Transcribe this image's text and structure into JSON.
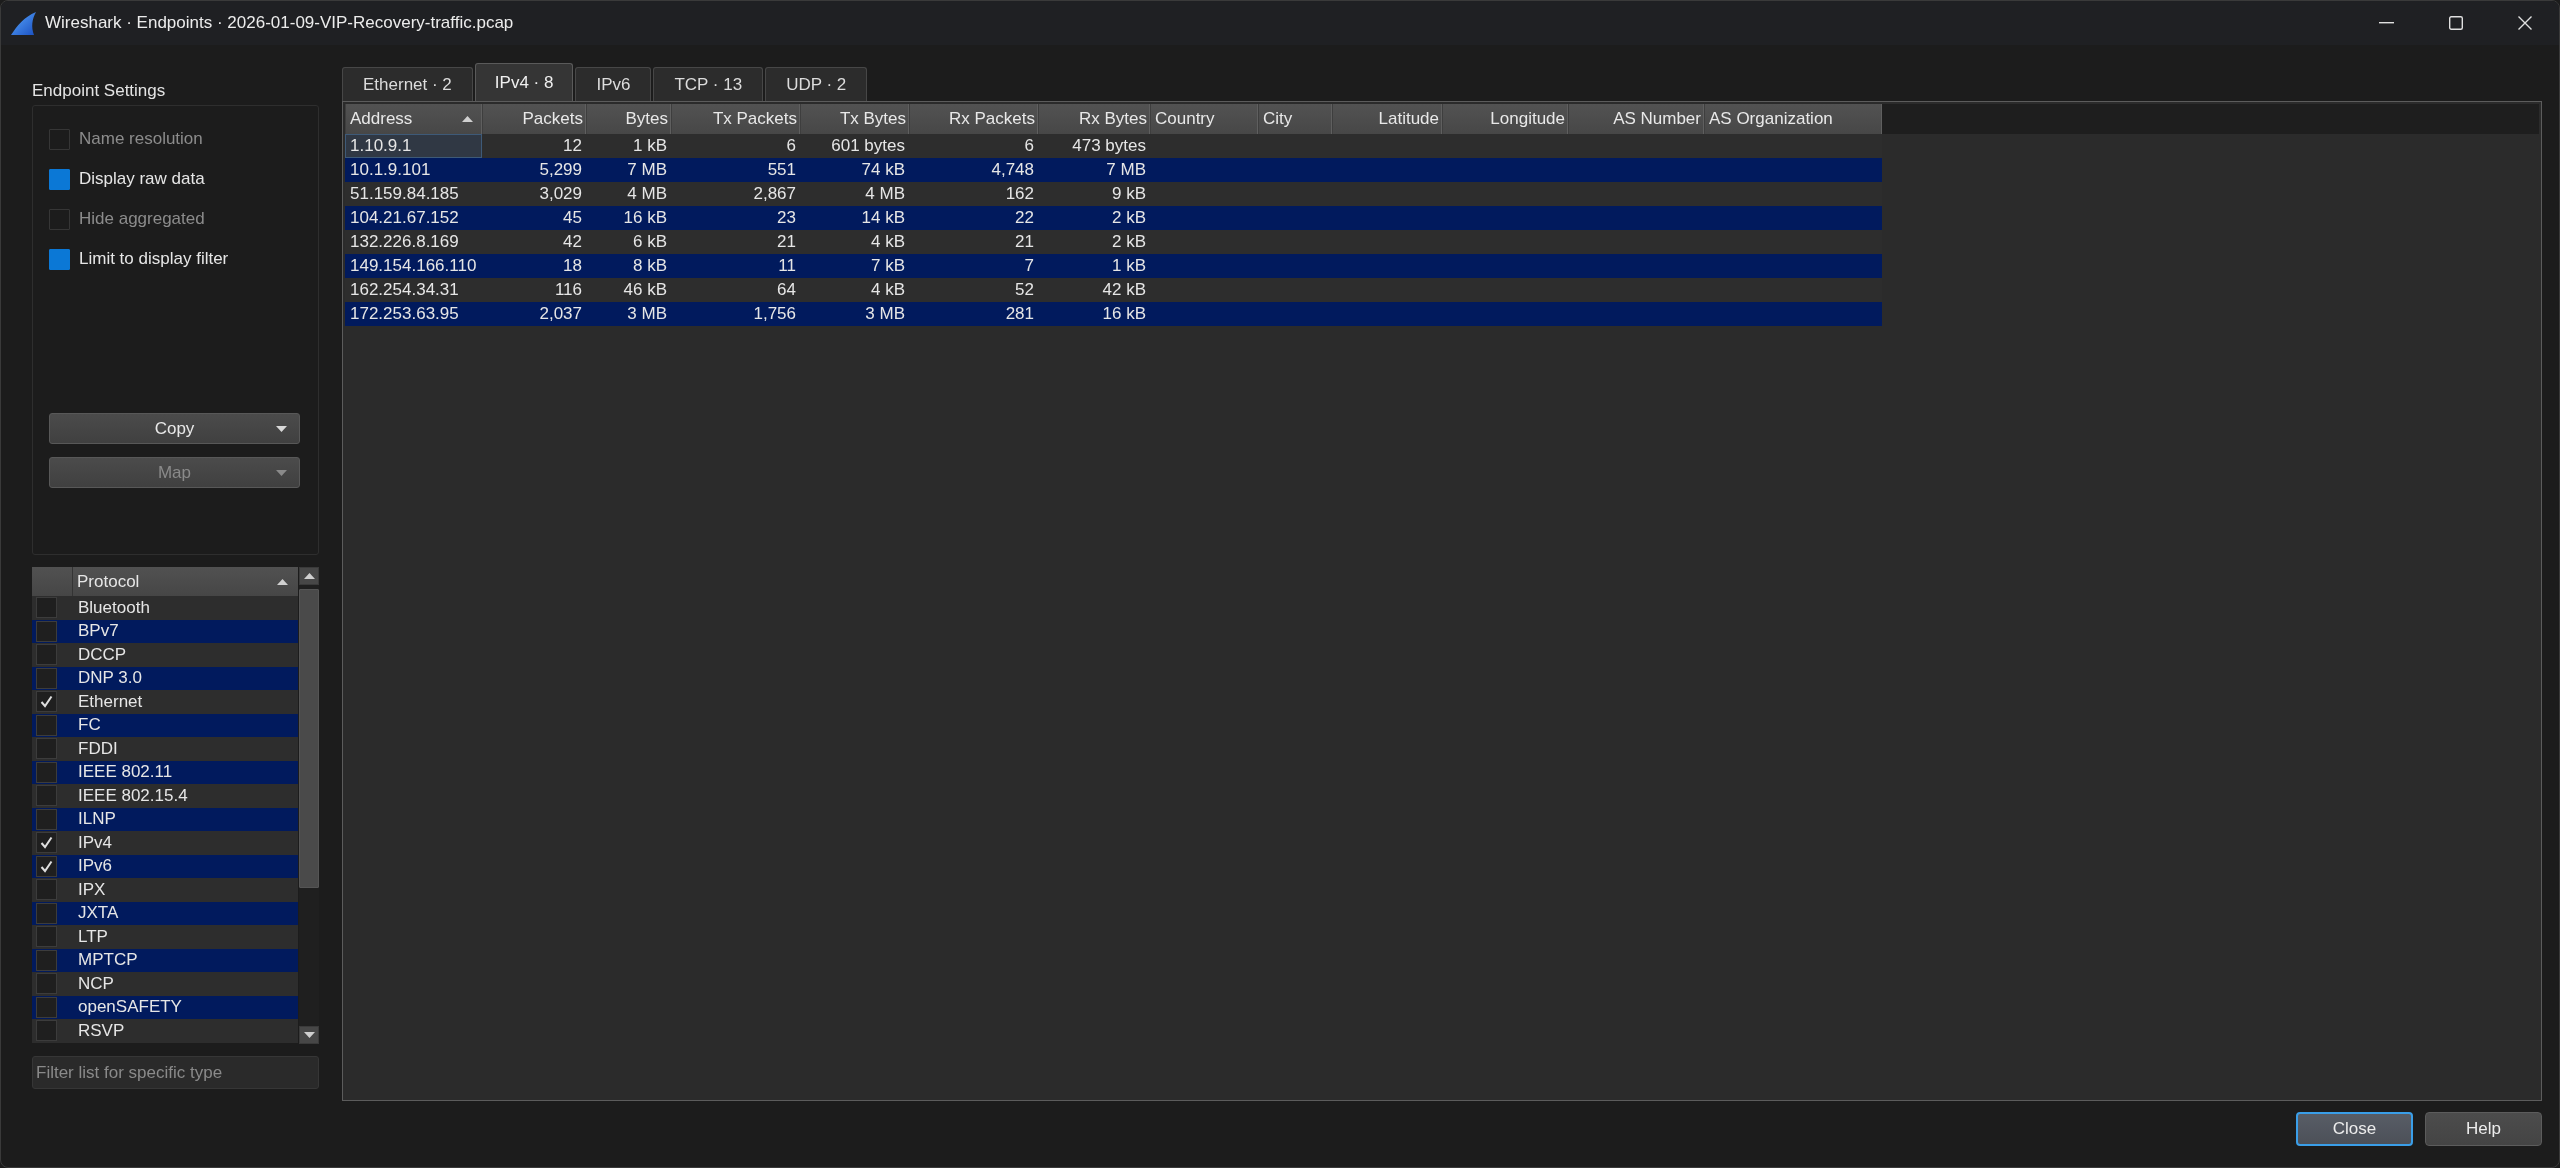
{
  "window": {
    "title": "Wireshark · Endpoints · 2026-01-09-VIP-Recovery-traffic.pcap"
  },
  "settings": {
    "title": "Endpoint Settings",
    "options": [
      {
        "label": "Name resolution",
        "checked": false,
        "disabled": true
      },
      {
        "label": "Display raw data",
        "checked": true,
        "disabled": false
      },
      {
        "label": "Hide aggregated",
        "checked": false,
        "disabled": true
      },
      {
        "label": "Limit to display filter",
        "checked": true,
        "disabled": false
      }
    ],
    "actions": [
      {
        "label": "Copy",
        "disabled": false
      },
      {
        "label": "Map",
        "disabled": true
      }
    ]
  },
  "protocols": {
    "header": {
      "label": "Protocol",
      "sorted": true
    },
    "items": [
      {
        "label": "Bluetooth",
        "checked": false
      },
      {
        "label": "BPv7",
        "checked": false
      },
      {
        "label": "DCCP",
        "checked": false
      },
      {
        "label": "DNP 3.0",
        "checked": false
      },
      {
        "label": "Ethernet",
        "checked": true
      },
      {
        "label": "FC",
        "checked": false
      },
      {
        "label": "FDDI",
        "checked": false
      },
      {
        "label": "IEEE 802.11",
        "checked": false
      },
      {
        "label": "IEEE 802.15.4",
        "checked": false
      },
      {
        "label": "ILNP",
        "checked": false
      },
      {
        "label": "IPv4",
        "checked": true
      },
      {
        "label": "IPv6",
        "checked": true
      },
      {
        "label": "IPX",
        "checked": false
      },
      {
        "label": "JXTA",
        "checked": false
      },
      {
        "label": "LTP",
        "checked": false
      },
      {
        "label": "MPTCP",
        "checked": false
      },
      {
        "label": "NCP",
        "checked": false
      },
      {
        "label": "openSAFETY",
        "checked": false
      },
      {
        "label": "RSVP",
        "checked": false
      }
    ]
  },
  "filter": {
    "placeholder": "Filter list for specific type"
  },
  "tabs": [
    {
      "label": "Ethernet · 2",
      "selected": false
    },
    {
      "label": "IPv4 · 8",
      "selected": true
    },
    {
      "label": "IPv6",
      "selected": false
    },
    {
      "label": "TCP · 13",
      "selected": false
    },
    {
      "label": "UDP · 2",
      "selected": false
    }
  ],
  "table": {
    "columns": [
      {
        "label": "Address",
        "sorted": true
      },
      {
        "label": "Packets",
        "sorted": false
      },
      {
        "label": "Bytes",
        "sorted": false
      },
      {
        "label": "Tx Packets",
        "sorted": false
      },
      {
        "label": "Tx Bytes",
        "sorted": false
      },
      {
        "label": "Rx Packets",
        "sorted": false
      },
      {
        "label": "Rx Bytes",
        "sorted": false
      },
      {
        "label": "Country",
        "sorted": false
      },
      {
        "label": "City",
        "sorted": false
      },
      {
        "label": "Latitude",
        "sorted": false
      },
      {
        "label": "Longitude",
        "sorted": false
      },
      {
        "label": "AS Number",
        "sorted": false
      },
      {
        "label": "AS Organization",
        "sorted": false
      }
    ],
    "rows": [
      {
        "cells": [
          "1.10.9.1",
          "12",
          "1 kB",
          "6",
          "601 bytes",
          "6",
          "473 bytes"
        ],
        "focused": true
      },
      {
        "cells": [
          "10.1.9.101",
          "5,299",
          "7 MB",
          "551",
          "74 kB",
          "4,748",
          "7 MB"
        ],
        "focused": false
      },
      {
        "cells": [
          "51.159.84.185",
          "3,029",
          "4 MB",
          "2,867",
          "4 MB",
          "162",
          "9 kB"
        ],
        "focused": false
      },
      {
        "cells": [
          "104.21.67.152",
          "45",
          "16 kB",
          "23",
          "14 kB",
          "22",
          "2 kB"
        ],
        "focused": false
      },
      {
        "cells": [
          "132.226.8.169",
          "42",
          "6 kB",
          "21",
          "4 kB",
          "21",
          "2 kB"
        ],
        "focused": false
      },
      {
        "cells": [
          "149.154.166.110",
          "18",
          "8 kB",
          "11",
          "7 kB",
          "7",
          "1 kB"
        ],
        "focused": false
      },
      {
        "cells": [
          "162.254.34.31",
          "116",
          "46 kB",
          "64",
          "4 kB",
          "52",
          "42 kB"
        ],
        "focused": false
      },
      {
        "cells": [
          "172.253.63.95",
          "2,037",
          "3 MB",
          "1,756",
          "3 MB",
          "281",
          "16 kB"
        ],
        "focused": false
      }
    ]
  },
  "buttons": [
    {
      "label": "Close",
      "default": true
    },
    {
      "label": "Help",
      "default": false
    }
  ]
}
